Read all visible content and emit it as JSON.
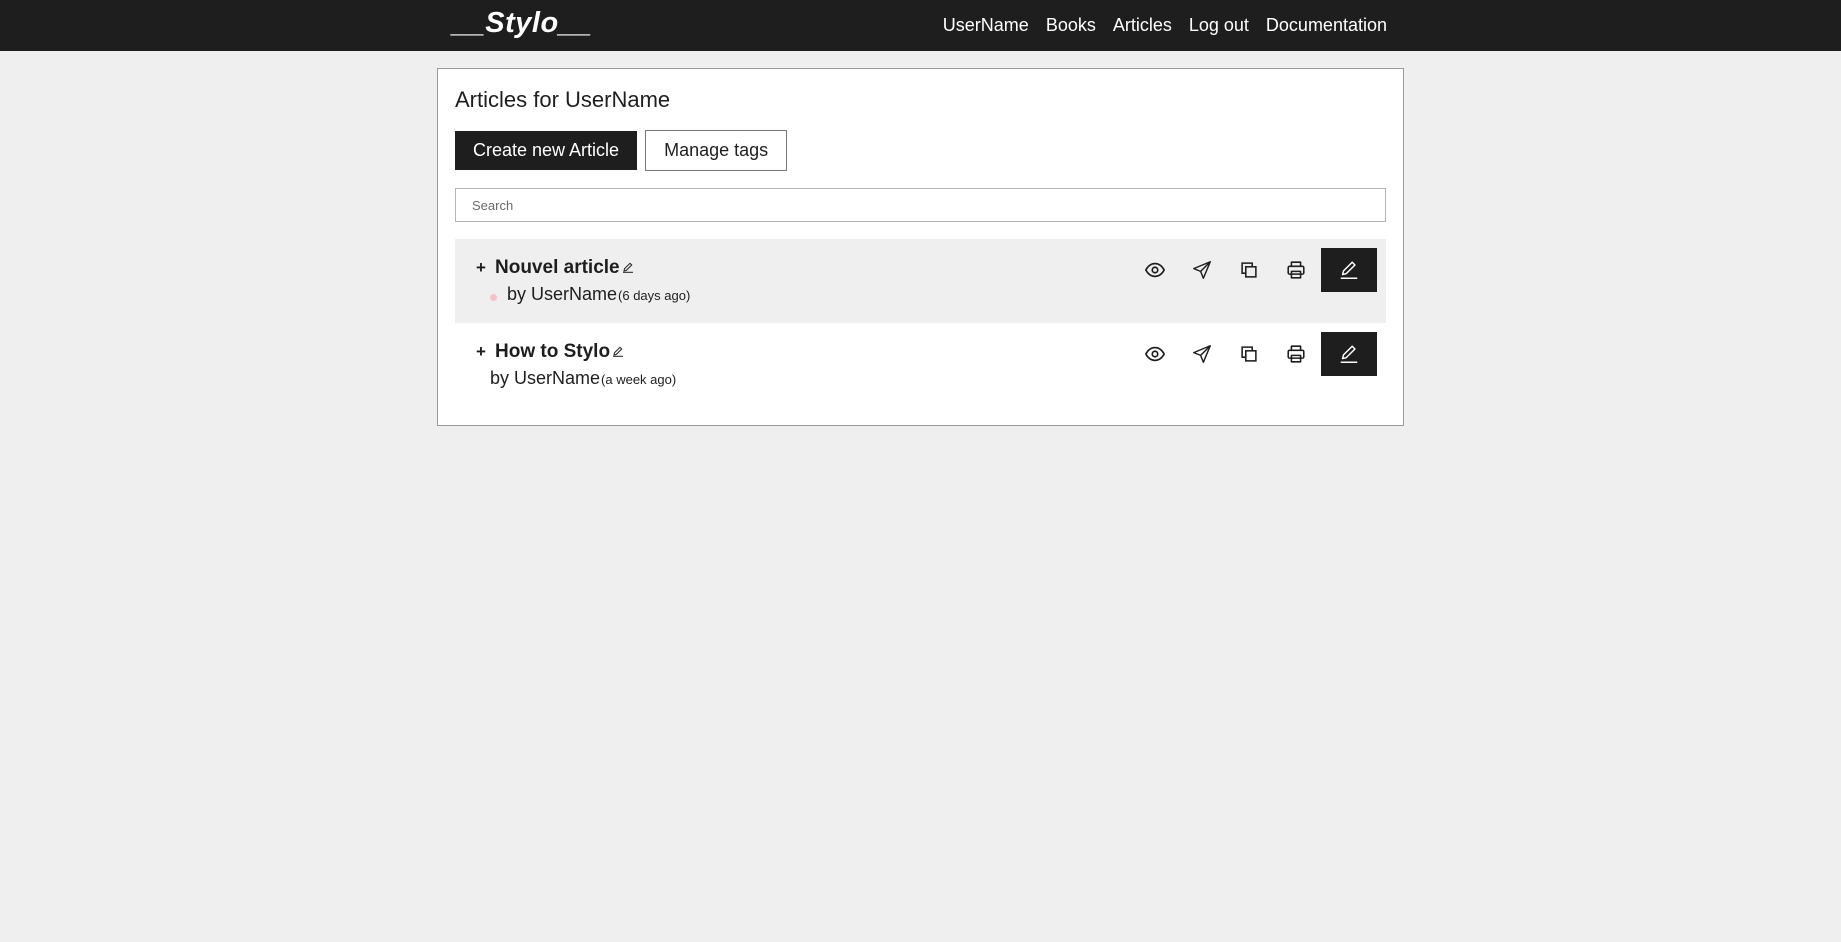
{
  "app": {
    "logo": "__Stylo__"
  },
  "nav": {
    "items": [
      {
        "label": "UserName"
      },
      {
        "label": "Books"
      },
      {
        "label": "Articles"
      },
      {
        "label": "Log out"
      },
      {
        "label": "Documentation"
      }
    ]
  },
  "page": {
    "title": "Articles for UserName",
    "create_label": "Create new Article",
    "tags_label": "Manage tags",
    "search_placeholder": "Search"
  },
  "articles": [
    {
      "expand": "+",
      "title": "Nouvel article",
      "author": "by UserName",
      "when": "(6 days ago)"
    },
    {
      "expand": "+",
      "title": "How to Stylo",
      "author": "by UserName",
      "when": "(a week ago)"
    }
  ],
  "icons": {
    "preview": "eye-icon",
    "share": "send-icon",
    "duplicate": "copy-icon",
    "export": "printer-icon",
    "edit": "pencil-icon"
  },
  "colors": {
    "dark": "#1e1e1e",
    "background": "#efefef",
    "tag_dot": "#f4c2c7"
  }
}
